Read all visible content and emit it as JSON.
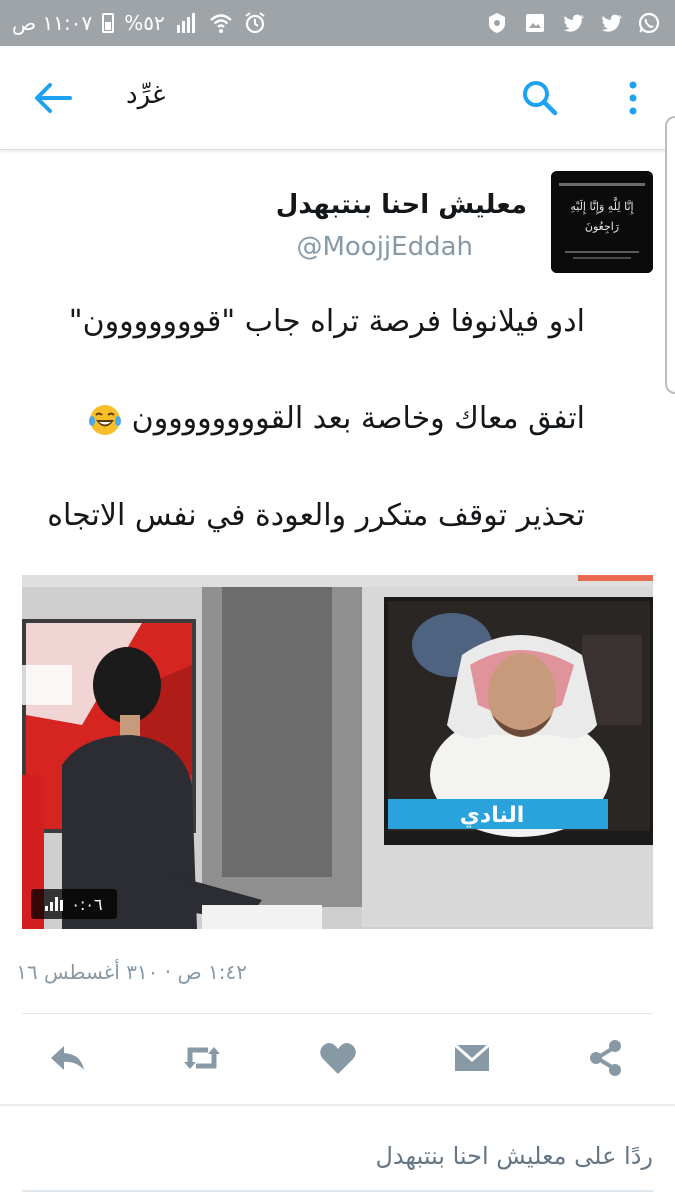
{
  "status_bar": {
    "time": "١١:٠٧ ص",
    "battery": "%٥٢"
  },
  "app_bar": {
    "title": "غرِّد"
  },
  "tweet": {
    "display_name": "معليش احنا بنتبهدل",
    "handle": "@MoojjEddah",
    "avatar_text": "إِنَّا لِلَّهِ وَإِنَّا إِلَيْهِ رَاجِعُونَ",
    "lines": [
      "ادو فيلانوفا فرصة تراه جاب \"قووووووون\"",
      "اتفق معاك وخاصة بعد القوووووووون",
      "تحذير توقف متكرر والعودة في نفس الاتجاه"
    ],
    "media": {
      "duration": "٠:٠٦",
      "channel_logo": "النادي"
    },
    "timestamp": "١:٤٢ ص · ٣١٠ أغسطس ١٦"
  },
  "actions": [
    "reply-icon",
    "retweet-icon",
    "like-icon",
    "message-icon",
    "share-icon"
  ],
  "reply": {
    "placeholder": "ردًا على معليش احنا بنتبهدل"
  },
  "colors": {
    "accent": "#1da1f2",
    "status_bar": "#9fa4a9",
    "action_icon": "#8899a6",
    "secondary_text": "#8899a6"
  }
}
